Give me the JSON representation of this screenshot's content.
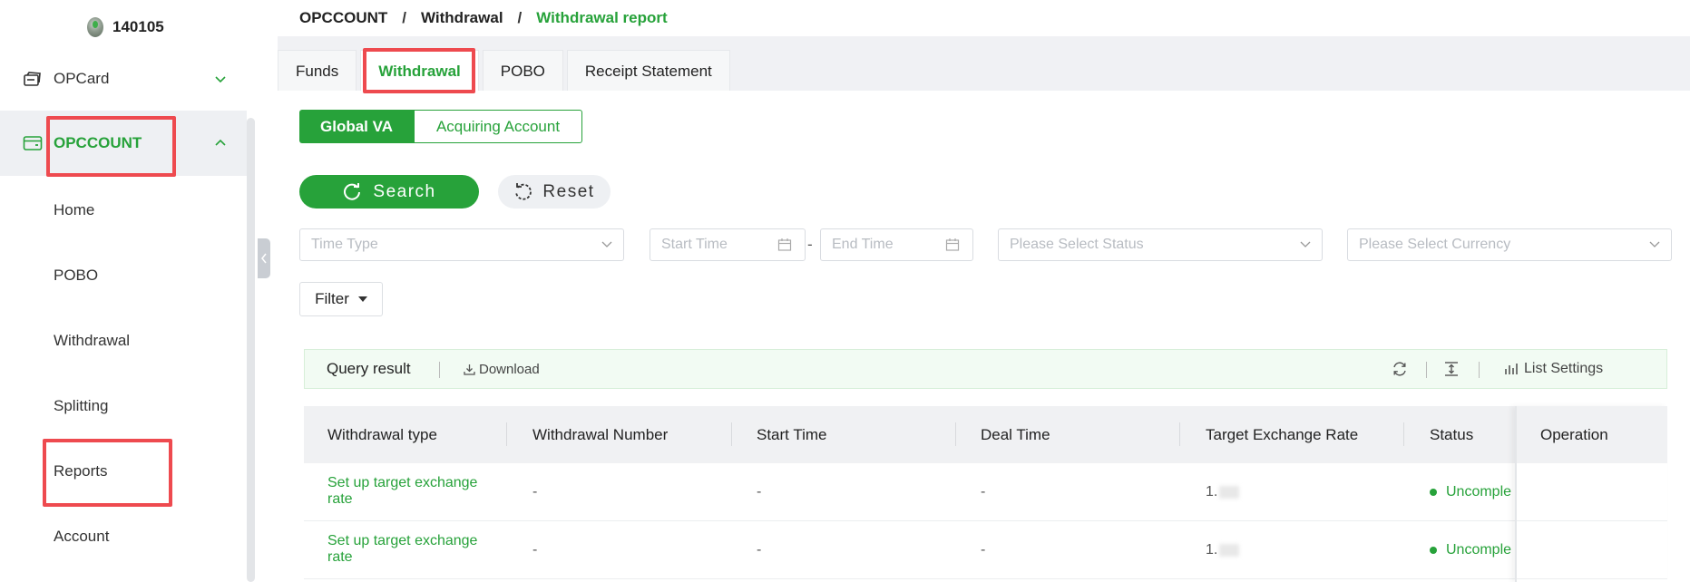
{
  "account": {
    "id": "140105"
  },
  "sidebar": {
    "items": [
      {
        "label": "OPCard",
        "icon": "card-stack-icon",
        "state": "collapsed"
      },
      {
        "label": "OPCCOUNT",
        "icon": "wallet-icon",
        "state": "expanded"
      }
    ],
    "subitems": [
      {
        "label": "Home"
      },
      {
        "label": "POBO"
      },
      {
        "label": "Withdrawal"
      },
      {
        "label": "Splitting"
      },
      {
        "label": "Reports"
      },
      {
        "label": "Account"
      }
    ]
  },
  "breadcrumb": {
    "items": [
      "OPCCOUNT",
      "Withdrawal",
      "Withdrawal report"
    ],
    "separator": "/"
  },
  "tabs": [
    {
      "label": "Funds",
      "active": false
    },
    {
      "label": "Withdrawal",
      "active": true
    },
    {
      "label": "POBO",
      "active": false
    },
    {
      "label": "Receipt Statement",
      "active": false
    }
  ],
  "segment": {
    "options": [
      "Global VA",
      "Acquiring Account"
    ],
    "selected": "Global VA"
  },
  "actions": {
    "search_label": "Search",
    "reset_label": "Reset",
    "filter_label": "Filter"
  },
  "filters": {
    "time_type_placeholder": "Time Type",
    "start_time_placeholder": "Start Time",
    "end_time_placeholder": "End Time",
    "range_separator": "-",
    "status_placeholder": "Please Select Status",
    "currency_placeholder": "Please Select Currency"
  },
  "query_bar": {
    "title": "Query result",
    "download_label": "Download",
    "list_settings_label": "List Settings"
  },
  "table": {
    "columns": [
      "Withdrawal type",
      "Withdrawal Number",
      "Start Time",
      "Deal Time",
      "Target Exchange Rate",
      "Status",
      "Operation"
    ],
    "rows": [
      {
        "type": "Set up target exchange rate",
        "number": "-",
        "start": "-",
        "deal": "-",
        "rate": "1.",
        "status": "Uncomple"
      },
      {
        "type": "Set up target exchange rate",
        "number": "-",
        "start": "-",
        "deal": "-",
        "rate": "1.",
        "status": "Uncomple"
      }
    ]
  },
  "colors": {
    "accent": "#27a23a",
    "highlight": "#ee4a4f",
    "active_bg": "#eef0f3"
  }
}
